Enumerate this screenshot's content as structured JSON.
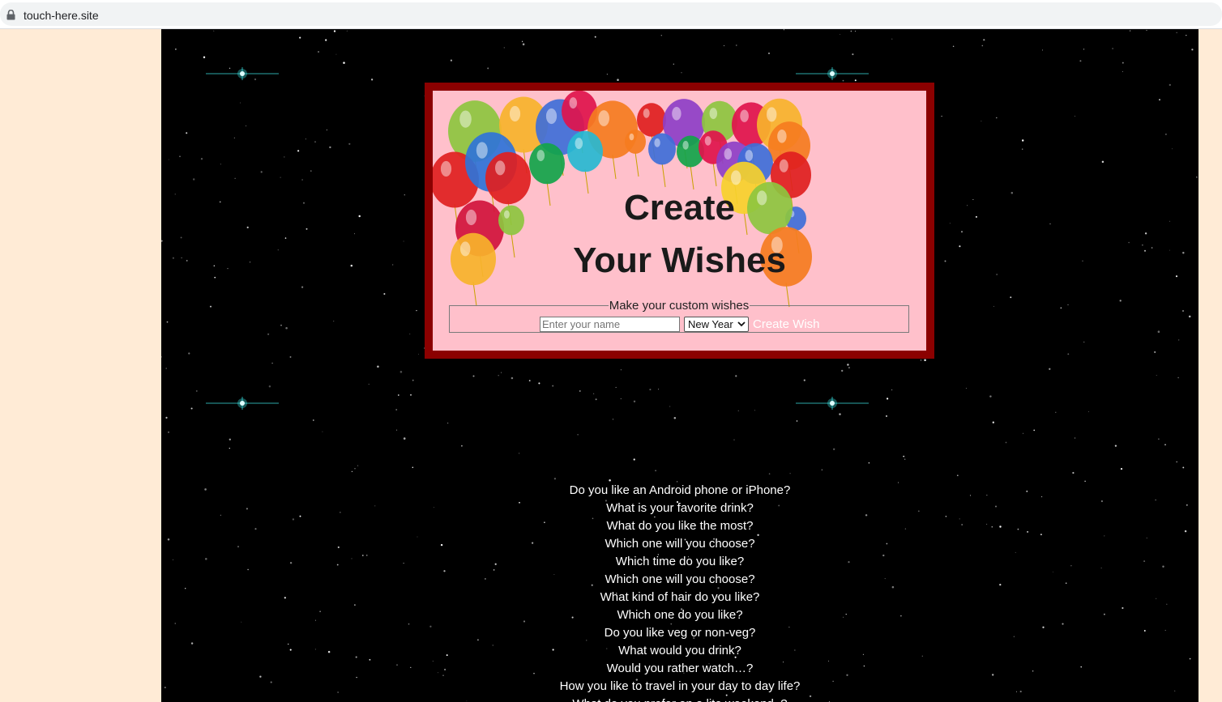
{
  "browser": {
    "url": "touch-here.site"
  },
  "card": {
    "heading_line1": "Create",
    "heading_line2": "Your Wishes",
    "form": {
      "legend": "Make your custom wishes",
      "name_placeholder": "Enter your name",
      "occasion_selected": "New Year",
      "submit_label": "Create Wish"
    }
  },
  "questions": [
    "Do you like an Android phone or iPhone?",
    "What is your favorite drink?",
    "What do you like the most?",
    "Which one will you choose?",
    "Which time do you like?",
    "Which one will you choose?",
    "What kind of hair do you like?",
    "Which one do you like?",
    "Do you like veg or non-veg?",
    "What would you drink?",
    "Would you rather watch…?",
    "How you like to travel in your day to day life?",
    "What do you prefer on a lite weekend..?"
  ],
  "colors": {
    "page_bg": "#ffebd6",
    "main_bg": "#000000",
    "card_border": "#8b0000",
    "card_bg": "#ffc0cb",
    "sparkle": "#3ff0f0"
  }
}
